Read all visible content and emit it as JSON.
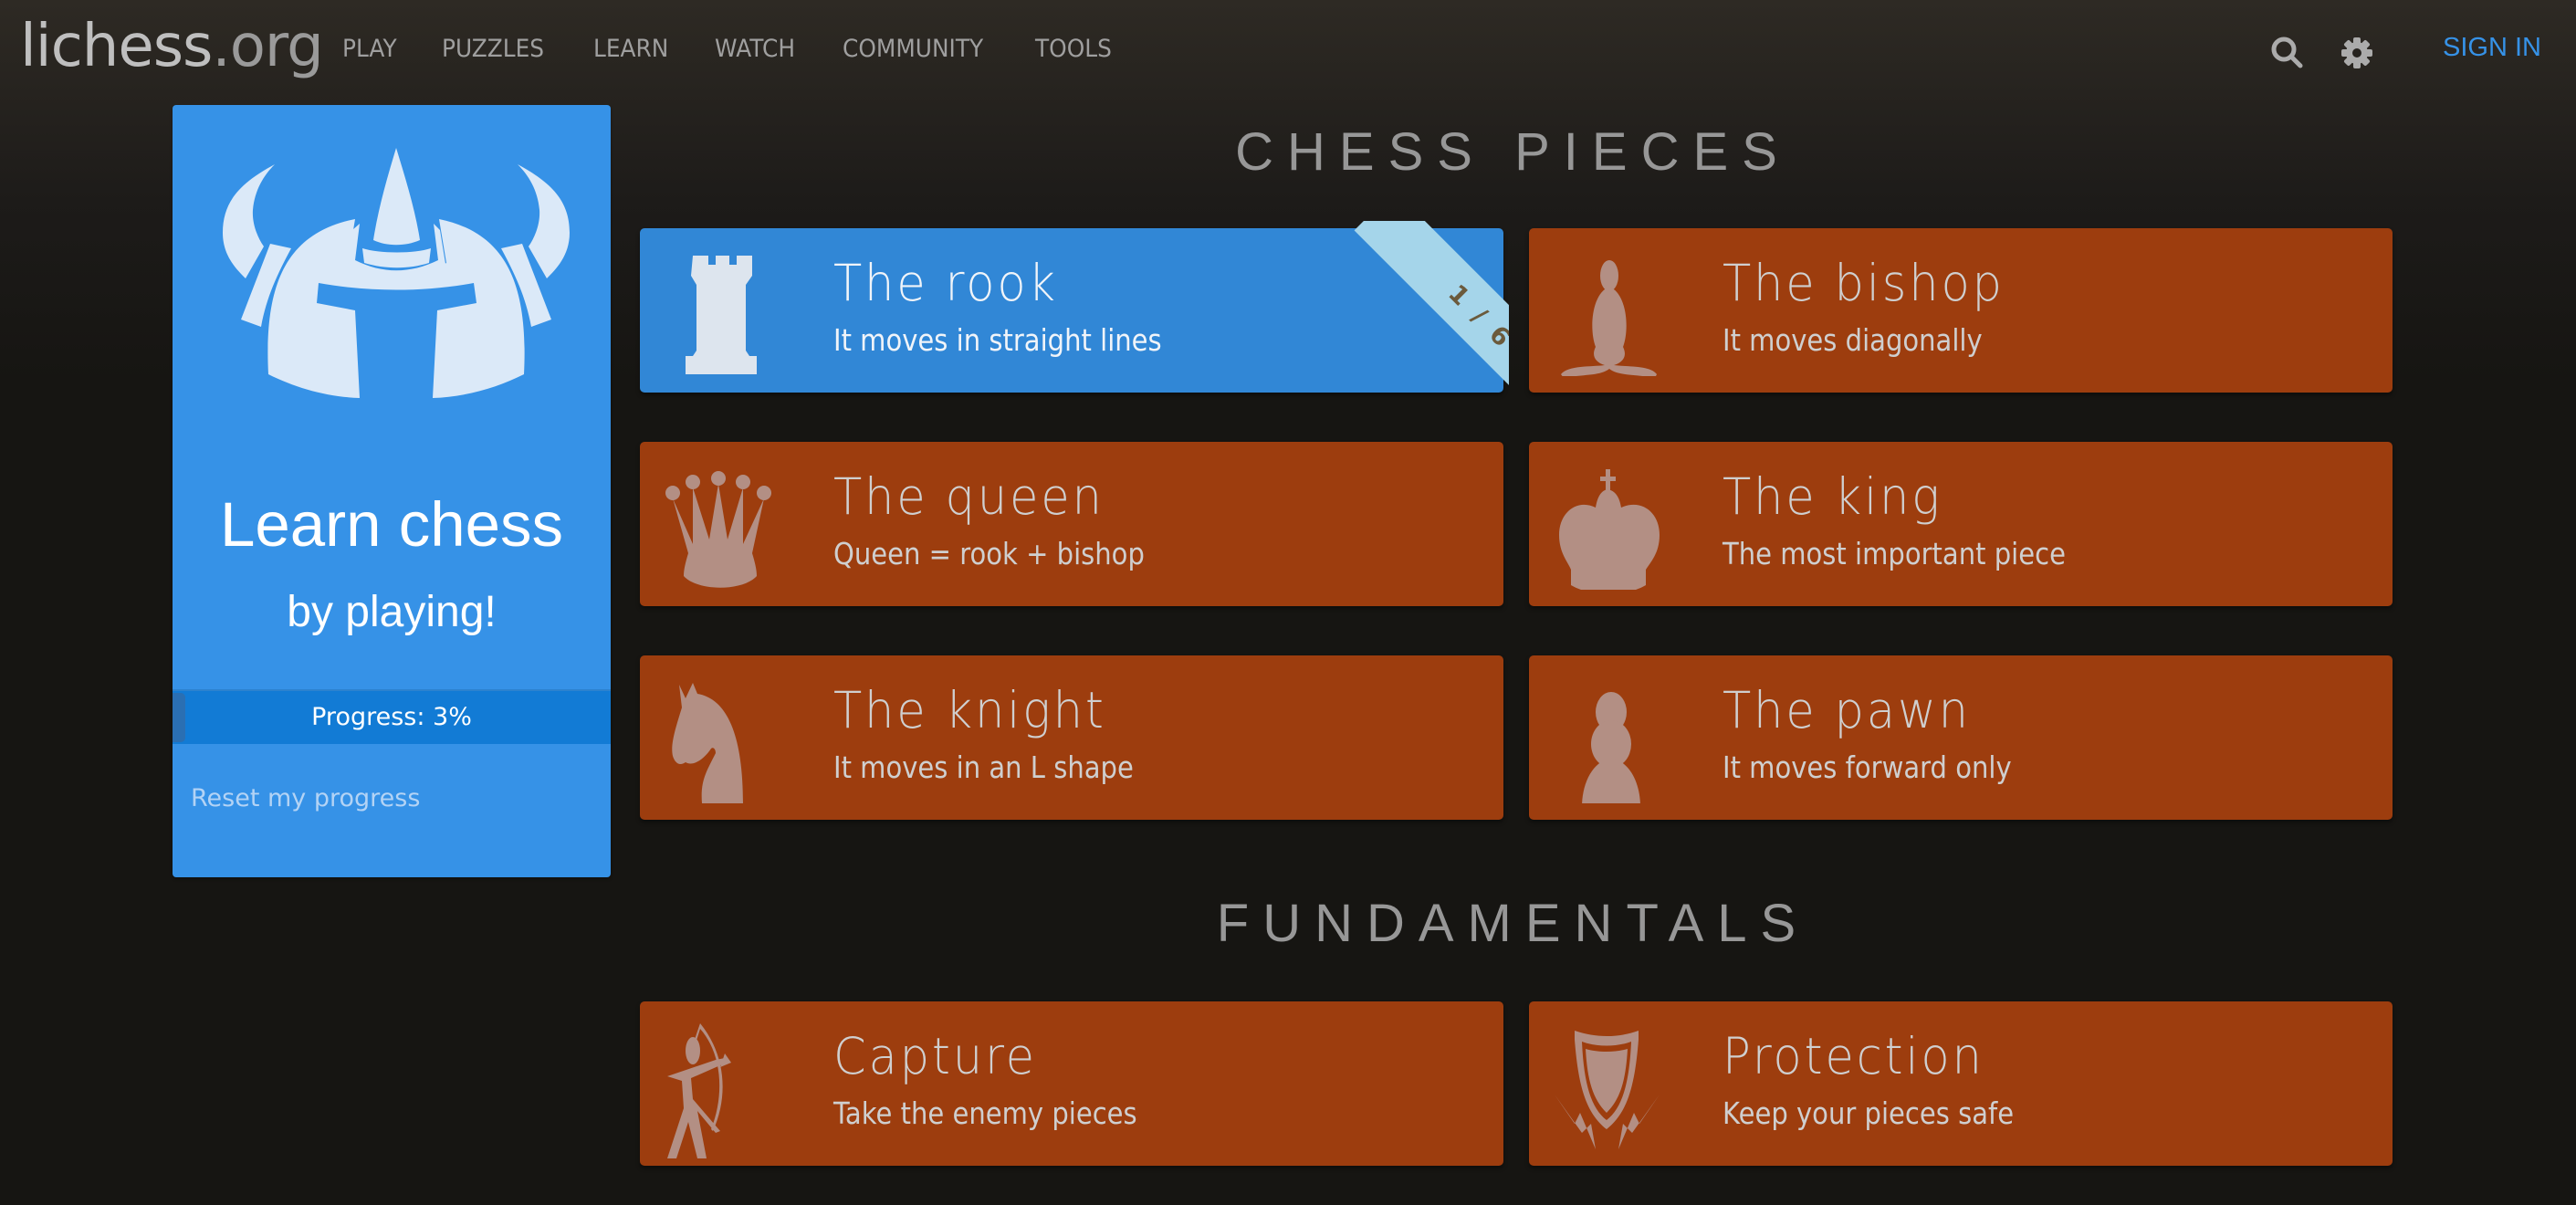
{
  "header": {
    "logo_main": "lichess",
    "logo_tld": ".org",
    "nav": [
      "PLAY",
      "PUZZLES",
      "LEARN",
      "WATCH",
      "COMMUNITY",
      "TOOLS"
    ],
    "search_icon": "search-icon",
    "settings_icon": "gear-icon",
    "signin": "SIGN IN",
    "signin_color": "#3692e7"
  },
  "sidebar": {
    "icon": "viking-helmet-icon",
    "title": "Learn chess",
    "subtitle": "by playing!",
    "progress_label": "Progress: 3%",
    "progress_percent": 3,
    "reset": "Reset my progress",
    "color": "#3692e7"
  },
  "sections": [
    {
      "title": "CHESS PIECES",
      "stages": [
        {
          "title": "The rook",
          "subtitle": "It moves in straight lines",
          "icon": "rook-icon",
          "active": true,
          "ribbon": "1/6"
        },
        {
          "title": "The bishop",
          "subtitle": "It moves diagonally",
          "icon": "bishop-icon",
          "active": false
        },
        {
          "title": "The queen",
          "subtitle": "Queen = rook + bishop",
          "icon": "queen-icon",
          "active": false
        },
        {
          "title": "The king",
          "subtitle": "The most important piece",
          "icon": "king-icon",
          "active": false
        },
        {
          "title": "The knight",
          "subtitle": "It moves in an L shape",
          "icon": "knight-icon",
          "active": false
        },
        {
          "title": "The pawn",
          "subtitle": "It moves forward only",
          "icon": "pawn-icon",
          "active": false
        }
      ]
    },
    {
      "title": "FUNDAMENTALS",
      "stages": [
        {
          "title": "Capture",
          "subtitle": "Take the enemy pieces",
          "icon": "archer-icon",
          "active": false
        },
        {
          "title": "Protection",
          "subtitle": "Keep your pieces safe",
          "icon": "shield-icon",
          "active": false
        }
      ]
    }
  ],
  "colors": {
    "active_card": "#3187d6",
    "inactive_card": "#9d3d0e",
    "ribbon": "#a5d5ea"
  }
}
